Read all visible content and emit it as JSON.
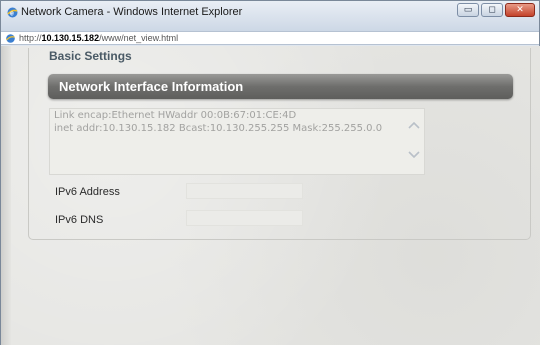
{
  "window": {
    "title": "Network Camera - Windows Internet Explorer",
    "buttons": {
      "minimize": "▭",
      "maximize": "◻",
      "close": "✕"
    }
  },
  "address": {
    "prefix": "http://",
    "host": "10.130.15.182",
    "path": "/www/net_view.html"
  },
  "page": {
    "section_title": "Basic Settings",
    "header": "Network Interface Information",
    "info_lines": [
      "Link encap:Ethernet  HWaddr 00:0B:67:01:CE:4D",
      "inet addr:10.130.15.182  Bcast:10.130.255.255  Mask:255.255.0.0"
    ],
    "fields": {
      "ipv6_address": {
        "label": "IPv6 Address",
        "value": ""
      },
      "ipv6_dns": {
        "label": "IPv6 DNS",
        "value": ""
      }
    }
  },
  "colors": {
    "header_bar": "#6e6e6c",
    "page_bg": "#e5e5e2",
    "info_text": "#a2a2a0"
  },
  "icons": {
    "title": "ie-icon",
    "address": "ie-page-icon",
    "scroll_up": "chevron-up-icon",
    "scroll_down": "chevron-down-icon"
  }
}
